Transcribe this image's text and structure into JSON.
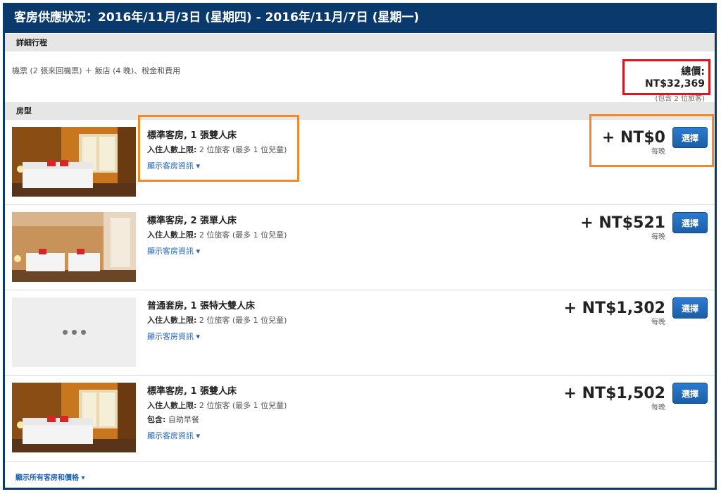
{
  "header": {
    "title": "客房供應狀況：2016年/11月/3日 (星期四) - 2016年/11月/7日 (星期一)"
  },
  "itinerary": {
    "section_label": "詳細行程",
    "description": "機票 (2 張來回機票) ＋ 飯店 (4 晚)、稅金和費用",
    "total_price": "總價: NT$32,369",
    "total_note": "(包含 2 位旅客)"
  },
  "rooms_section": {
    "label": "房型"
  },
  "rooms": [
    {
      "name": "標準客房, 1 張雙人床",
      "capacity_label": "入住人數上限:",
      "capacity_value": " 2 位旅客 (最多 1 位兒童)",
      "extra": "",
      "link": "顯示客房資訊 ▾",
      "price": "+ NT$0",
      "per_night": "每晚",
      "button": "選擇",
      "image": "hotel-room-double"
    },
    {
      "name": "標準客房, 2 張單人床",
      "capacity_label": "入住人數上限:",
      "capacity_value": " 2 位旅客 (最多 1 位兒童)",
      "extra": "",
      "link": "顯示客房資訊 ▾",
      "price": "+ NT$521",
      "per_night": "每晚",
      "button": "選擇",
      "image": "hotel-room-twin"
    },
    {
      "name": "普通套房, 1 張特大雙人床",
      "capacity_label": "入住人數上限:",
      "capacity_value": " 2 位旅客 (最多 1 位兒童)",
      "extra": "",
      "link": "顯示客房資訊 ▾",
      "price": "+ NT$1,302",
      "per_night": "每晚",
      "button": "選擇",
      "image": "no-image-placeholder"
    },
    {
      "name": "標準客房, 1 張雙人床",
      "capacity_label": "入住人數上限:",
      "capacity_value": " 2 位旅客 (最多 1 位兒童)",
      "extra_label": "包含:",
      "extra": " 自助早餐",
      "link": "顯示客房資訊 ▾",
      "price": "+ NT$1,502",
      "per_night": "每晚",
      "button": "選擇",
      "image": "hotel-room-double"
    }
  ],
  "footer": {
    "show_all": "顯示所有客房和價格 ▾"
  },
  "colors": {
    "header_bg": "#0a3a6b",
    "link": "#1e63b6",
    "button": "#1b5fa8",
    "highlight_red": "#e0141e",
    "highlight_orange": "#f08a2c"
  }
}
